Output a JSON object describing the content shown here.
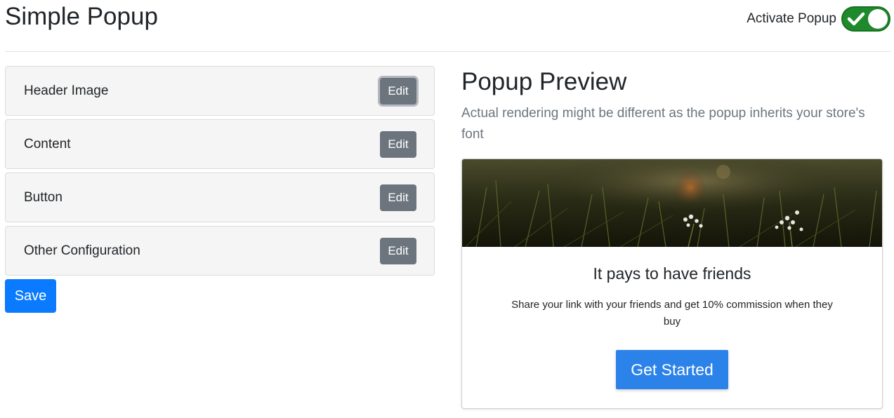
{
  "page": {
    "title": "Simple Popup"
  },
  "activate": {
    "label": "Activate Popup",
    "enabled": true,
    "toggle_color": "#1f8a2b"
  },
  "sections": [
    {
      "label": "Header Image",
      "edit_label": "Edit",
      "focused": true
    },
    {
      "label": "Content",
      "edit_label": "Edit"
    },
    {
      "label": "Button",
      "edit_label": "Edit"
    },
    {
      "label": "Other Configuration",
      "edit_label": "Edit"
    }
  ],
  "save_label": "Save",
  "preview": {
    "title": "Popup Preview",
    "note": "Actual rendering might be different as the popup inherits your store's font",
    "popup": {
      "header_image": "meadow-flowers-photo",
      "heading": "It pays to have friends",
      "text": "Share your link with your friends and get 10% commission when they buy",
      "cta_label": "Get Started"
    }
  },
  "colors": {
    "primary": "#0a7bff",
    "secondary": "#6c757d",
    "cta": "#2b82e8"
  }
}
